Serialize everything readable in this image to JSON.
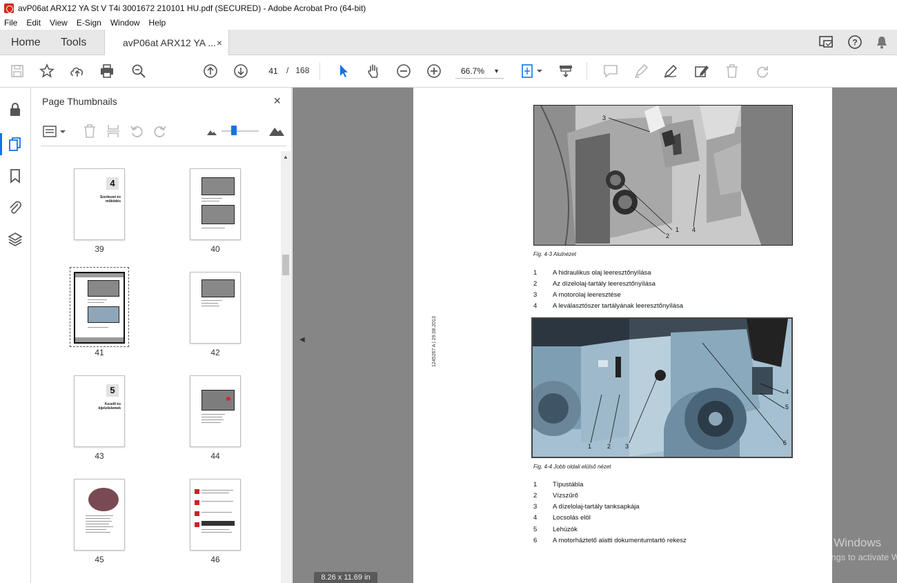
{
  "window": {
    "title": "avP06at ARX12 YA St V T4i 3001672 210101 HU.pdf (SECURED) - Adobe Acrobat Pro (64-bit)"
  },
  "menu": [
    "File",
    "Edit",
    "View",
    "E-Sign",
    "Window",
    "Help"
  ],
  "tabs": {
    "home": "Home",
    "tools": "Tools",
    "document": "avP06at ARX12 YA ...",
    "close": "×"
  },
  "toolbar": {
    "current_page": "41",
    "page_separator": "/",
    "total_pages": "168",
    "zoom": "66.7%"
  },
  "panel": {
    "title": "Page Thumbnails",
    "close": "×"
  },
  "thumbnails": [
    {
      "label": "39",
      "chapter": "4",
      "chapter_title": "Szerkezet és\nműködés"
    },
    {
      "label": "40"
    },
    {
      "label": "41",
      "selected": true
    },
    {
      "label": "42"
    },
    {
      "label": "43",
      "chapter": "5",
      "chapter_title": "Kezelő és\nkijelzőelemek"
    },
    {
      "label": "44"
    },
    {
      "label": "45"
    },
    {
      "label": "46"
    }
  ],
  "page": {
    "side_text": "1245267 A | 29.08.2013",
    "fig1_caption": "Fig. 4-3 Alulnézet",
    "fig1_callouts": [
      "3",
      "1",
      "4",
      "2"
    ],
    "fig1_legend": [
      {
        "num": "1",
        "text": "A hidraulikus olaj leeresztőnyílása"
      },
      {
        "num": "2",
        "text": "Az dízelolaj-tartály leeresztőnyílása"
      },
      {
        "num": "3",
        "text": "A motorolaj leeresztése"
      },
      {
        "num": "4",
        "text": "A leválasztószer tartályának leeresztőnyílása"
      }
    ],
    "fig2_caption": "Fig. 4-4 Jobb oldali elülső nézet",
    "fig2_callouts": [
      "1",
      "2",
      "3",
      "4",
      "5",
      "6"
    ],
    "fig2_legend": [
      {
        "num": "1",
        "text": "Típustábla"
      },
      {
        "num": "2",
        "text": "Vízszűrő"
      },
      {
        "num": "3",
        "text": "A dízelolaj-tartály tanksapkája"
      },
      {
        "num": "4",
        "text": "Locsolás elöl"
      },
      {
        "num": "5",
        "text": "Lehúzók"
      },
      {
        "num": "6",
        "text": "A motorháztető alatti dokumentumtartó rekesz"
      }
    ]
  },
  "status": {
    "page_size": "8.26 x 11.69 in"
  },
  "watermark": {
    "line1": "Activate Windows",
    "line2": "Go to Settings to activate Windows."
  },
  "colors": {
    "accent": "#1473e6",
    "doc_bg": "#868686",
    "acrobat_red": "#d7281f"
  }
}
